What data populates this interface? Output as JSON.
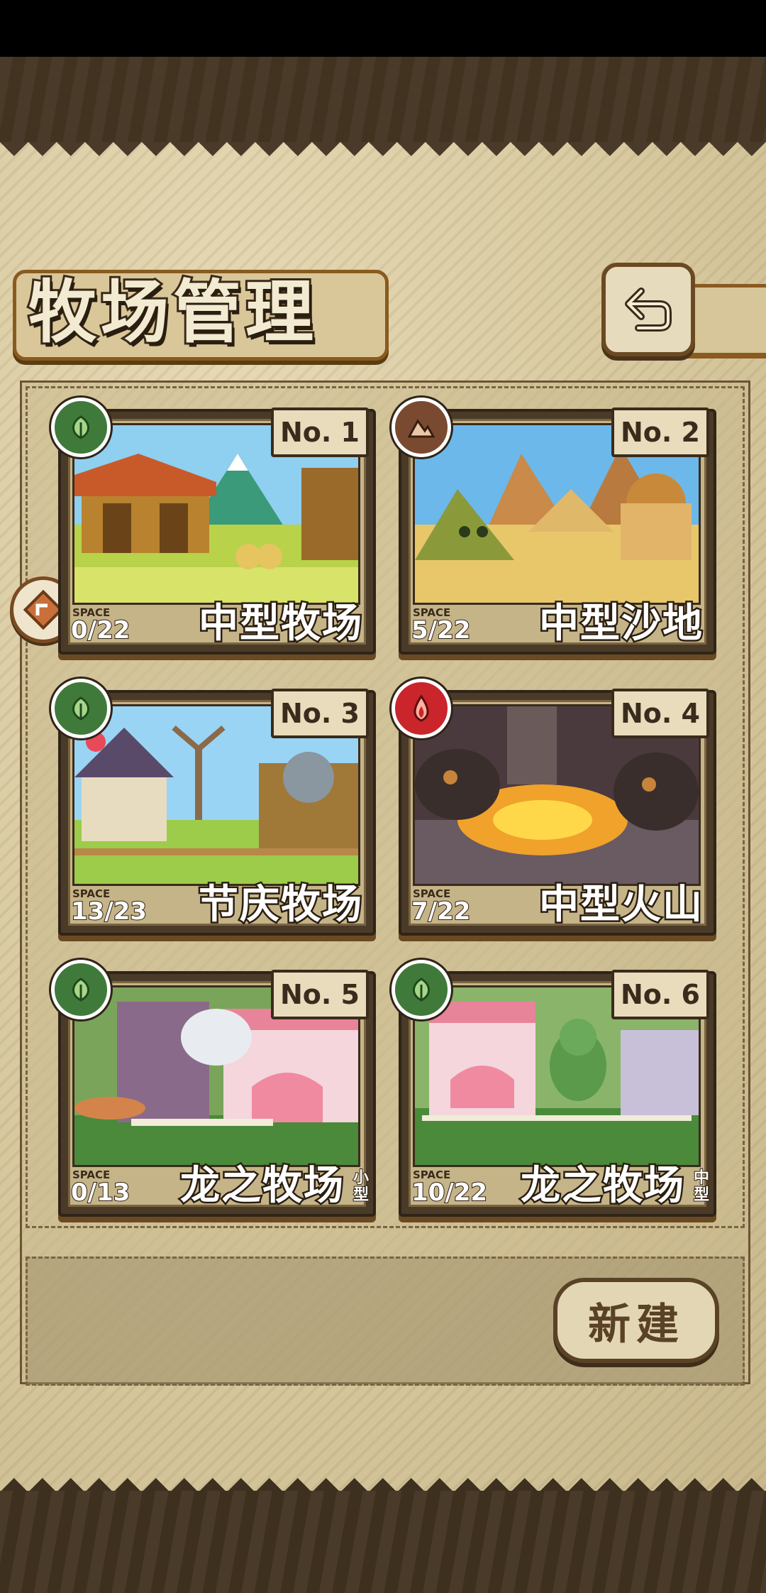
{
  "header": {
    "title": "牧场管理",
    "back_icon": "return-arrow-icon"
  },
  "footer": {
    "new_label": "新建"
  },
  "colors": {
    "grass_badge": "#3f7a3a",
    "mountain_badge": "#7a4a30",
    "fire_badge": "#c9252a"
  },
  "ranches": [
    {
      "number": "No. 1",
      "badge": "leaf-icon",
      "space_label": "SPACE",
      "space": "0/22",
      "name": "中型牧场",
      "size": ""
    },
    {
      "number": "No. 2",
      "badge": "mountain-icon",
      "space_label": "SPACE",
      "space": "5/22",
      "name": "中型沙地",
      "size": ""
    },
    {
      "number": "No. 3",
      "badge": "leaf-icon",
      "space_label": "SPACE",
      "space": "13/23",
      "name": "节庆牧场",
      "size": ""
    },
    {
      "number": "No. 4",
      "badge": "flame-icon",
      "space_label": "SPACE",
      "space": "7/22",
      "name": "中型火山",
      "size": ""
    },
    {
      "number": "No. 5",
      "badge": "leaf-icon",
      "space_label": "SPACE",
      "space": "0/13",
      "name": "龙之牧场",
      "size": "小型"
    },
    {
      "number": "No. 6",
      "badge": "leaf-icon",
      "space_label": "SPACE",
      "space": "10/22",
      "name": "龙之牧场",
      "size": "中型"
    }
  ]
}
